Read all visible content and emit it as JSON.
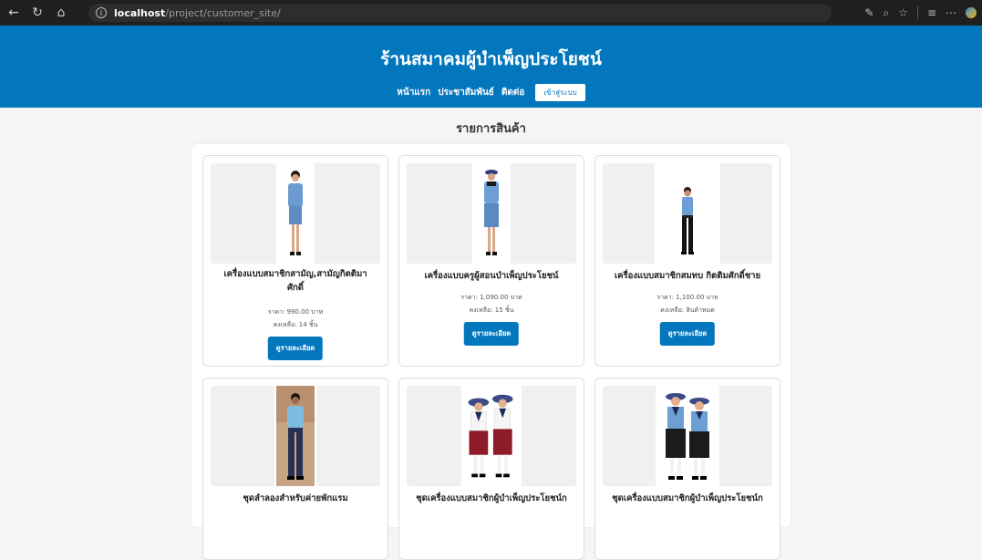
{
  "browser": {
    "url_host": "localhost",
    "url_path": "/project/customer_site/"
  },
  "header": {
    "site_title": "ร้านสมาคมผู้บำเพ็ญประโยชน์",
    "nav": [
      "หน้าแรก",
      "ประชาสัมพันธ์",
      "ติดต่อ"
    ],
    "login_label": "เข้าสู่ระบบ"
  },
  "main": {
    "heading": "รายการสินค้า",
    "products": [
      {
        "title": "เครื่องแบบสมาชิกสามัญ,สามัญกิตติมา",
        "title2": "ศักดิ์",
        "price": "ราคา: 990.00 บาท",
        "stock": "คงเหลือ: 14 ชิ้น",
        "button": "ดูรายละเอียด"
      },
      {
        "title": "เครื่องแบบครูผู้สอนบำเพ็ญประโยชน์",
        "price": "ราคา: 1,090.00 บาท",
        "stock": "คงเหลือ: 15 ชิ้น",
        "button": "ดูรายละเอียด"
      },
      {
        "title": "เครื่องแบบสมาชิกสมทบ กิตติมศักดิ์ชาย",
        "price": "ราคา: 1,100.00 บาท",
        "stock": "คงเหลือ: สินค้าหมด",
        "button": "ดูรายละเอียด"
      },
      {
        "title": "ชุดลำลองสำหรับค่ายพักแรม"
      },
      {
        "title": "ชุดเครื่องแบบสมาชิกผู้บำเพ็ญประโยชน์ก"
      },
      {
        "title": "ชุดเครื่องแบบสมาชิกผู้บำเพ็ญประโยชน์ก"
      }
    ]
  },
  "colors": {
    "brand": "#0277bd",
    "chrome": "#1f1f1f"
  }
}
